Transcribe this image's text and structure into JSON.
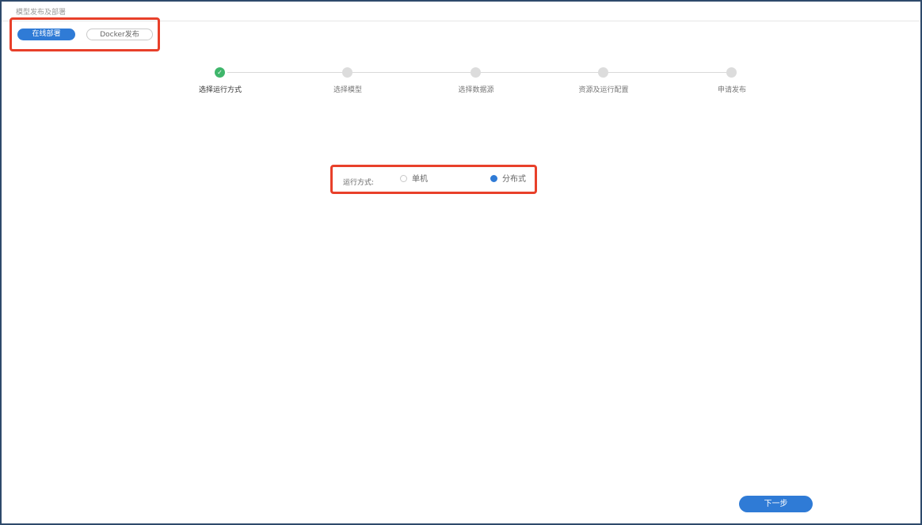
{
  "header": {
    "title": "模型发布及部署"
  },
  "mode_tabs": [
    {
      "label": "在线部署",
      "active": true
    },
    {
      "label": "Docker发布",
      "active": false
    }
  ],
  "steps": [
    {
      "label": "选择运行方式",
      "status": "done"
    },
    {
      "label": "选择模型",
      "status": "pending"
    },
    {
      "label": "选择数据源",
      "status": "pending"
    },
    {
      "label": "资源及运行配置",
      "status": "pending"
    },
    {
      "label": "申请发布",
      "status": "pending"
    }
  ],
  "run_mode": {
    "label": "运行方式:",
    "options": [
      {
        "label": "单机",
        "checked": false
      },
      {
        "label": "分布式",
        "checked": true
      }
    ]
  },
  "footer": {
    "next_label": "下一步"
  },
  "colors": {
    "accent": "#2f7bd6",
    "success": "#3fb66b",
    "highlight": "#e8402a",
    "frame": "#2e4a6b"
  }
}
